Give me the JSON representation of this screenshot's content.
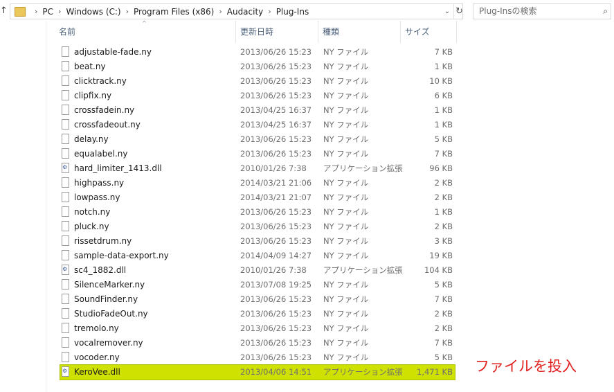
{
  "address_bar": {
    "up_arrow": "↑",
    "folder_icon": "folder-icon",
    "crumbs": [
      "PC",
      "Windows (C:)",
      "Program Files (x86)",
      "Audacity",
      "Plug-Ins"
    ],
    "separator": "›",
    "dropdown": "⌄",
    "refresh": "↻"
  },
  "search": {
    "placeholder": "Plug-Insの検索",
    "icon": "⌕"
  },
  "columns": {
    "name": "名前",
    "date": "更新日時",
    "type": "種類",
    "size": "サイズ",
    "sort_indicator": "^"
  },
  "files": [
    {
      "name": "adjustable-fade.ny",
      "date": "2013/06/26 15:23",
      "type": "NY ファイル",
      "size": "7 KB",
      "icon": "file-icon"
    },
    {
      "name": "beat.ny",
      "date": "2013/06/26 15:23",
      "type": "NY ファイル",
      "size": "1 KB",
      "icon": "file-icon"
    },
    {
      "name": "clicktrack.ny",
      "date": "2013/06/26 15:23",
      "type": "NY ファイル",
      "size": "10 KB",
      "icon": "file-icon"
    },
    {
      "name": "clipfix.ny",
      "date": "2013/06/26 15:23",
      "type": "NY ファイル",
      "size": "6 KB",
      "icon": "file-icon"
    },
    {
      "name": "crossfadein.ny",
      "date": "2013/04/25 16:37",
      "type": "NY ファイル",
      "size": "1 KB",
      "icon": "file-icon"
    },
    {
      "name": "crossfadeout.ny",
      "date": "2013/04/25 16:37",
      "type": "NY ファイル",
      "size": "1 KB",
      "icon": "file-icon"
    },
    {
      "name": "delay.ny",
      "date": "2013/06/26 15:23",
      "type": "NY ファイル",
      "size": "5 KB",
      "icon": "file-icon"
    },
    {
      "name": "equalabel.ny",
      "date": "2013/06/26 15:23",
      "type": "NY ファイル",
      "size": "7 KB",
      "icon": "file-icon"
    },
    {
      "name": "hard_limiter_1413.dll",
      "date": "2010/01/26 7:38",
      "type": "アプリケーション拡張",
      "size": "96 KB",
      "icon": "dll-icon"
    },
    {
      "name": "highpass.ny",
      "date": "2014/03/21 21:06",
      "type": "NY ファイル",
      "size": "2 KB",
      "icon": "file-icon"
    },
    {
      "name": "lowpass.ny",
      "date": "2014/03/21 21:07",
      "type": "NY ファイル",
      "size": "2 KB",
      "icon": "file-icon"
    },
    {
      "name": "notch.ny",
      "date": "2013/06/26 15:23",
      "type": "NY ファイル",
      "size": "1 KB",
      "icon": "file-icon"
    },
    {
      "name": "pluck.ny",
      "date": "2013/06/26 15:23",
      "type": "NY ファイル",
      "size": "2 KB",
      "icon": "file-icon"
    },
    {
      "name": "rissetdrum.ny",
      "date": "2013/06/26 15:23",
      "type": "NY ファイル",
      "size": "3 KB",
      "icon": "file-icon"
    },
    {
      "name": "sample-data-export.ny",
      "date": "2014/04/09 14:27",
      "type": "NY ファイル",
      "size": "19 KB",
      "icon": "file-icon"
    },
    {
      "name": "sc4_1882.dll",
      "date": "2010/01/26 7:38",
      "type": "アプリケーション拡張",
      "size": "104 KB",
      "icon": "dll-icon"
    },
    {
      "name": "SilenceMarker.ny",
      "date": "2013/07/08 19:25",
      "type": "NY ファイル",
      "size": "5 KB",
      "icon": "file-icon"
    },
    {
      "name": "SoundFinder.ny",
      "date": "2013/06/26 15:23",
      "type": "NY ファイル",
      "size": "7 KB",
      "icon": "file-icon"
    },
    {
      "name": "StudioFadeOut.ny",
      "date": "2013/06/26 15:23",
      "type": "NY ファイル",
      "size": "2 KB",
      "icon": "file-icon"
    },
    {
      "name": "tremolo.ny",
      "date": "2013/06/26 15:23",
      "type": "NY ファイル",
      "size": "2 KB",
      "icon": "file-icon"
    },
    {
      "name": "vocalremover.ny",
      "date": "2013/06/26 15:23",
      "type": "NY ファイル",
      "size": "7 KB",
      "icon": "file-icon"
    },
    {
      "name": "vocoder.ny",
      "date": "2013/06/26 15:23",
      "type": "NY ファイル",
      "size": "5 KB",
      "icon": "file-icon"
    },
    {
      "name": "KeroVee.dll",
      "date": "2013/04/06 14:51",
      "type": "アプリケーション拡張",
      "size": "1,471 KB",
      "icon": "dll-icon",
      "selected": true
    }
  ],
  "annotation": "ファイルを投入",
  "colors": {
    "highlight": "#cfe100",
    "annotation": "#e0201e",
    "header_text": "#4c607a"
  }
}
